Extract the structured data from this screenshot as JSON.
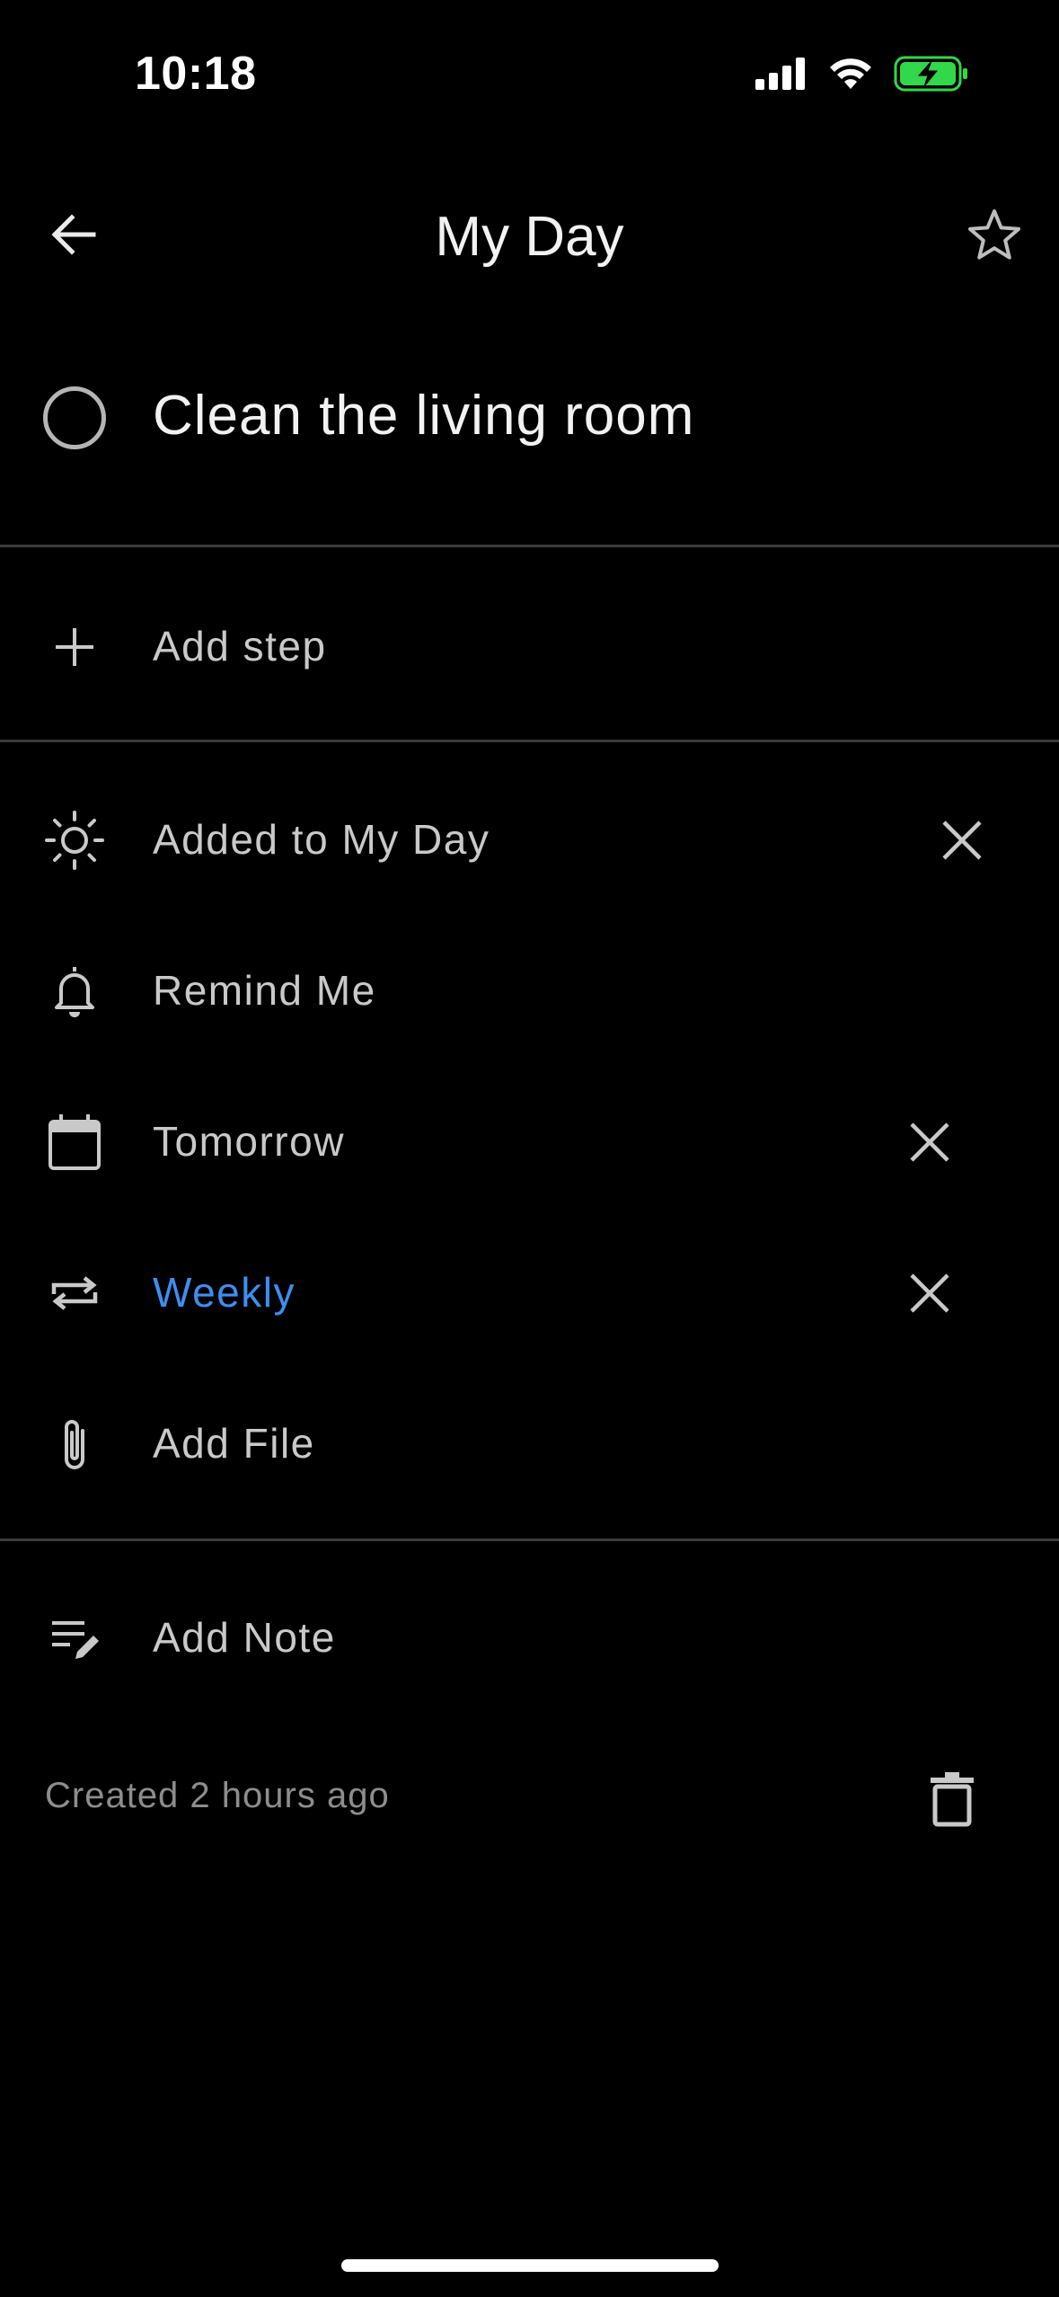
{
  "status_bar": {
    "time": "10:18",
    "signal_icon": "cellular-signal-icon",
    "wifi_icon": "wifi-icon",
    "battery_icon": "battery-charging-icon",
    "battery_color": "#32d74b"
  },
  "header": {
    "title": "My Day",
    "back_icon": "arrow-left-icon",
    "star_icon": "star-outline-icon"
  },
  "task": {
    "title": "Clean the living room",
    "completed": false
  },
  "steps": {
    "add_label": "Add step"
  },
  "details": [
    {
      "id": "my-day",
      "icon": "sun-icon",
      "label": "Added to My Day",
      "removable": true
    },
    {
      "id": "reminder",
      "icon": "bell-icon",
      "label": "Remind Me",
      "removable": false
    },
    {
      "id": "due-date",
      "icon": "calendar-icon",
      "label": "Tomorrow",
      "removable": true
    },
    {
      "id": "repeat",
      "icon": "repeat-icon",
      "label": "Weekly",
      "removable": true,
      "accent": "#3d8ef0"
    },
    {
      "id": "file",
      "icon": "paperclip-icon",
      "label": "Add File",
      "removable": false
    }
  ],
  "note": {
    "icon": "note-edit-icon",
    "label": "Add Note"
  },
  "footer": {
    "created_text": "Created 2 hours ago",
    "trash_icon": "trash-icon"
  },
  "colors": {
    "background": "#000000",
    "divider": "#3a3a3a",
    "text_primary": "#f2f2f2",
    "text_secondary": "#c9c9c9",
    "text_muted": "#8d8d8d",
    "accent": "#3d8ef0"
  }
}
